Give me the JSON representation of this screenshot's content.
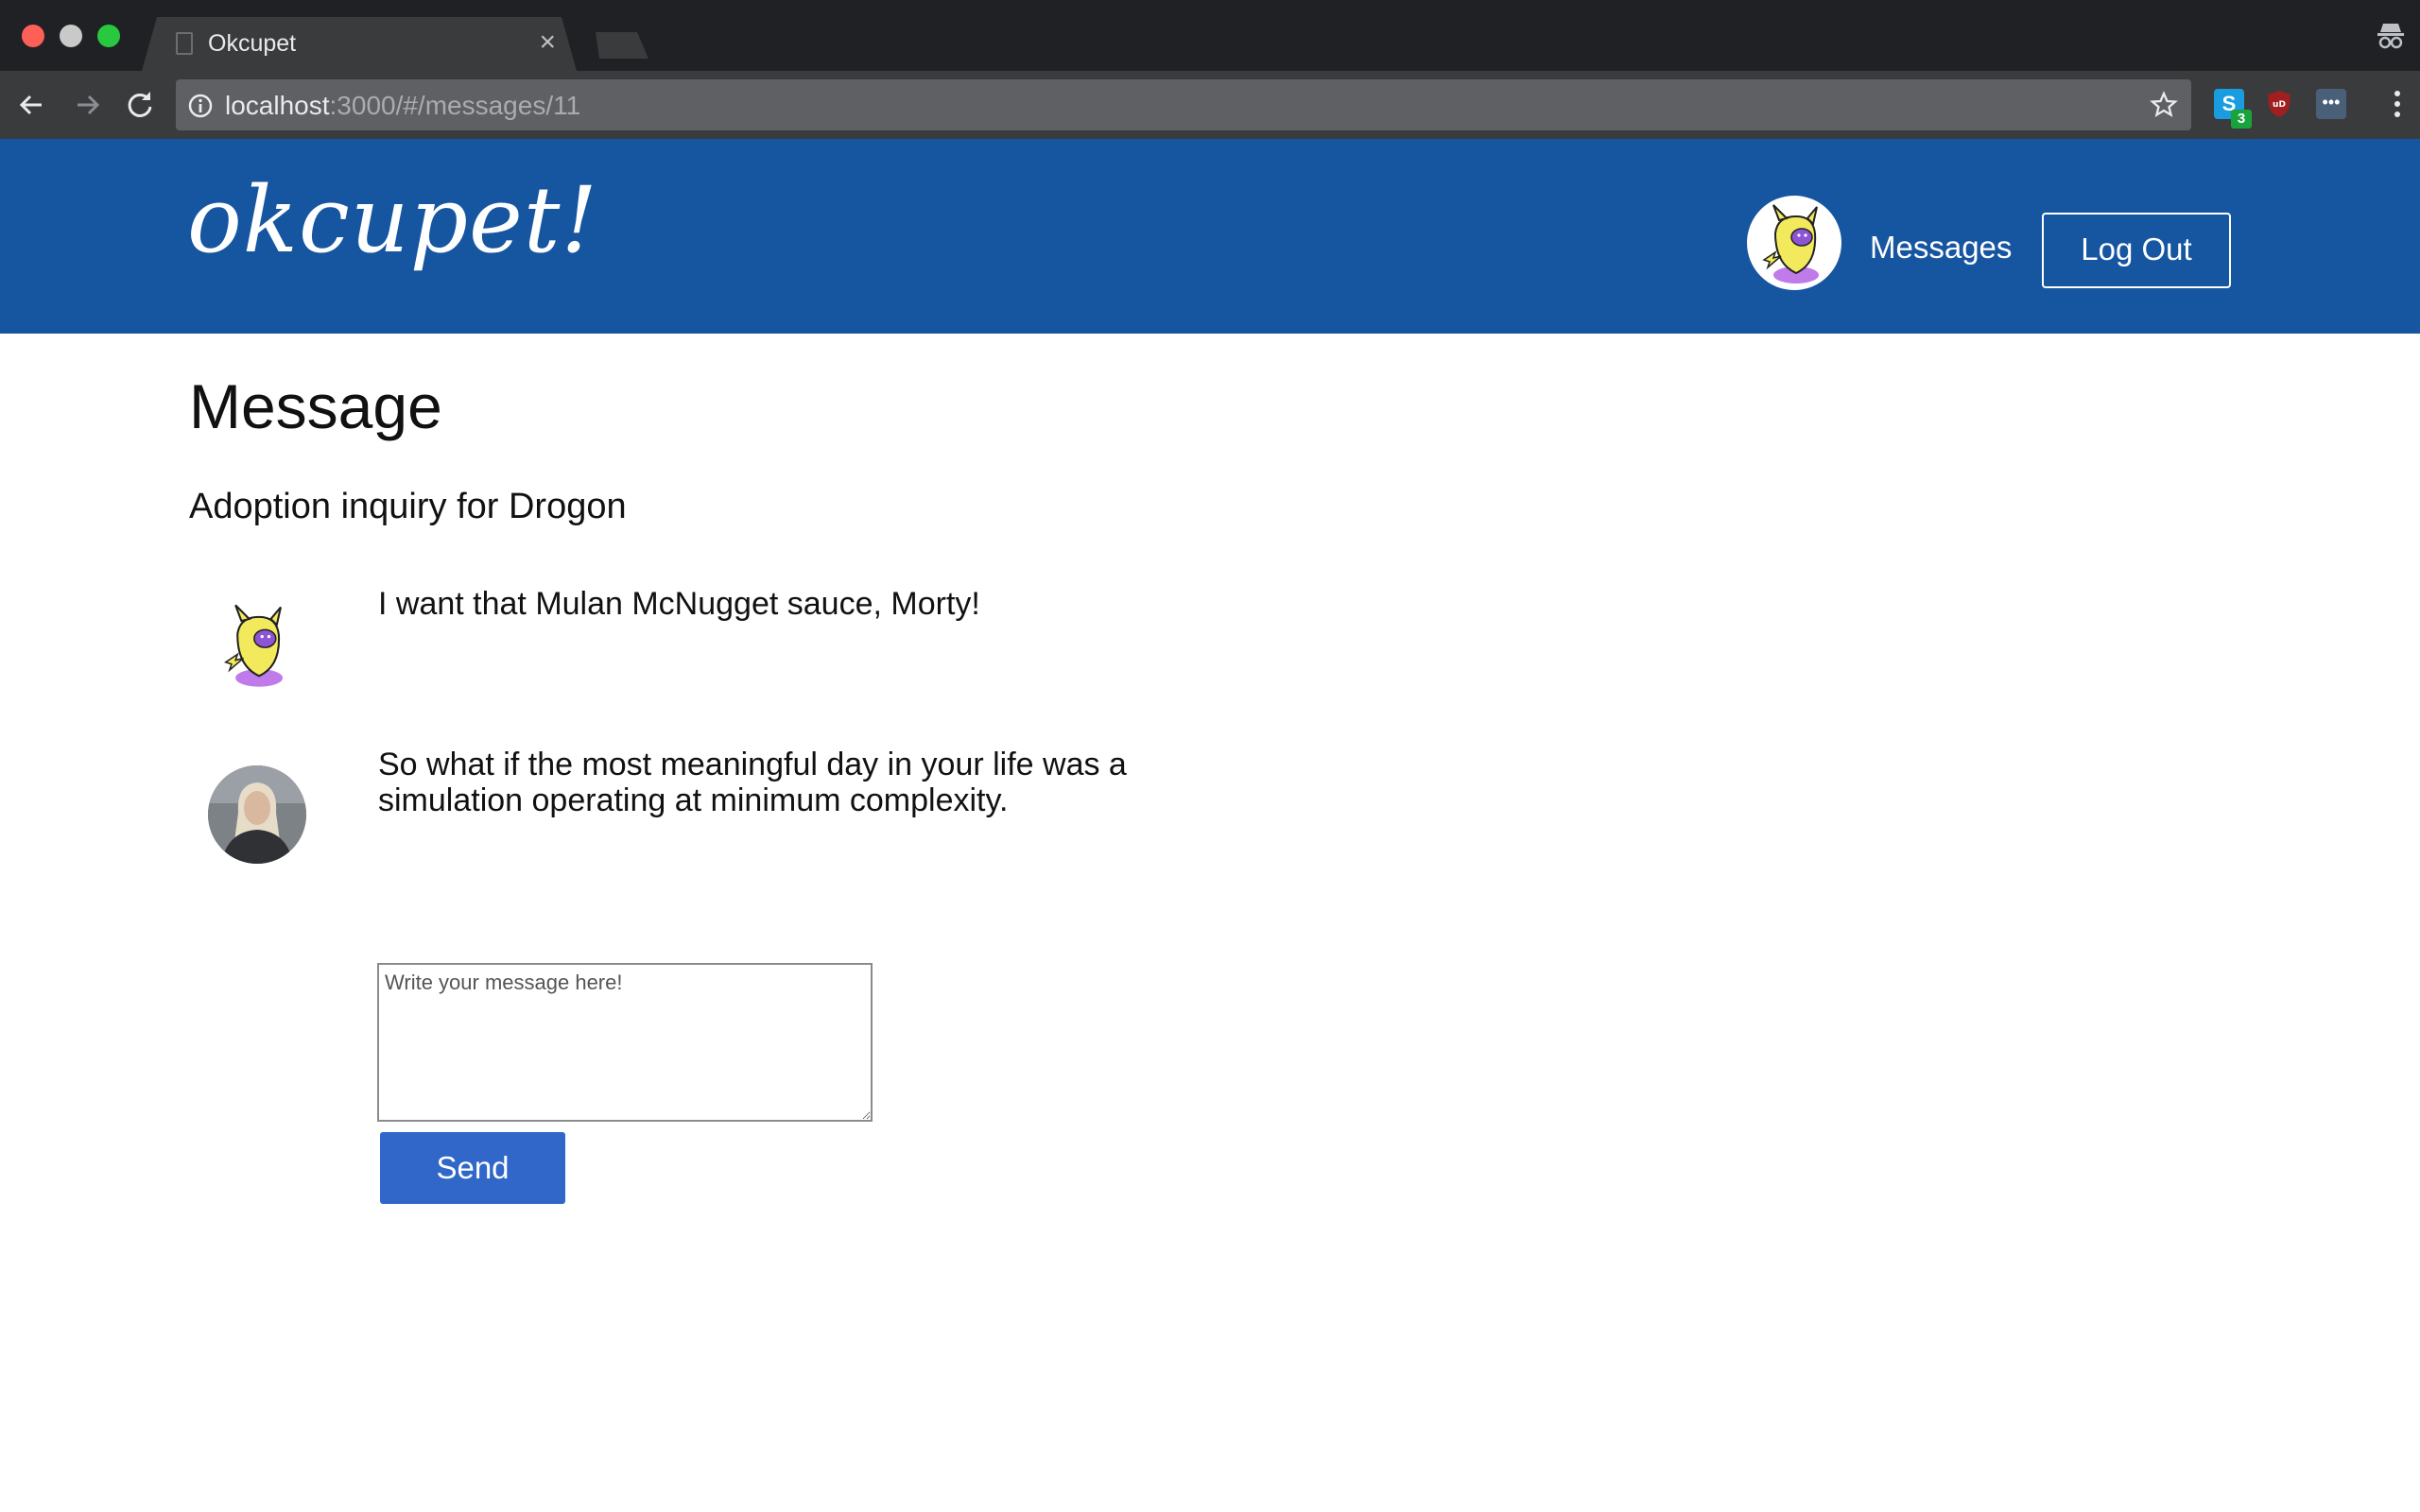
{
  "browser": {
    "tab_title": "Okcupet",
    "tab_close": "×",
    "url_host": "localhost",
    "url_rest": ":3000/#/messages/11",
    "extension_badge": "3",
    "extension_s_label": "S",
    "extension_ub_label": "uD",
    "extension_more_label": "•••"
  },
  "header": {
    "logo": "okcupet!",
    "nav_messages": "Messages",
    "logout_label": "Log Out"
  },
  "page": {
    "title": "Message",
    "subject": "Adoption inquiry for Drogon"
  },
  "messages": [
    {
      "avatar": "pikachu-ghost-avatar",
      "text": "I want that Mulan McNugget sauce, Morty!"
    },
    {
      "avatar": "user-photo-avatar",
      "text": "So what if the most meaningful day in your life was a simulation operating at minimum complexity."
    }
  ],
  "compose": {
    "placeholder": "Write your message here!",
    "send_label": "Send"
  },
  "colors": {
    "header_bg": "#1655a0",
    "send_button": "#3067c9"
  }
}
